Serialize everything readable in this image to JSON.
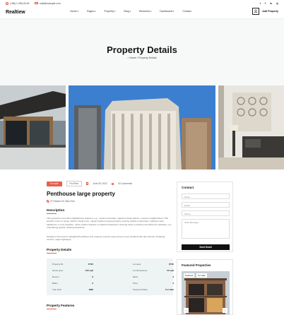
{
  "topbar": {
    "phone": "(+88) 1-256-26-45",
    "email": "mail@example.com",
    "socials": [
      "t",
      "f",
      "in",
      "◎"
    ]
  },
  "header": {
    "logo": "Realtiew",
    "nav": [
      "Home",
      "Pages",
      "Property",
      "Blog",
      "Elements",
      "Dashboard",
      "Contact"
    ],
    "add_property": "Add Property"
  },
  "hero": {
    "title": "Property Details",
    "breadcrumb": "⌂ Home  /  Property Details"
  },
  "listing": {
    "status": "For sale",
    "type": "For Rent",
    "date": "June 09, 2022",
    "comments": "00 Comments",
    "title": "Penthouse large property",
    "address": "27 Division St, New York"
  },
  "description": {
    "heading": "Description",
    "p1": "This property's loca offers highlight key features, e.g., modern amenities, spacious living spaces, a serene neighborhood. This specific rooms or areas, kitchen, living room, master bedroom layout property security granite countertops, stainless steel appliances, a cozy fireplace, views outdoor features. A spacious backyard, stunning views a private pool perfect for activities, e.g., entertaining guests, relaxing weekends.",
    "p2": "Situated in the heart of (Neighborhood/City), this property ensures easy access to key locations like (list schools, shopping centers, major highways)."
  },
  "details": {
    "heading": "Property Details",
    "left": [
      {
        "k": "Property ID:",
        "v": "P720"
      },
      {
        "k": "Home area:",
        "v": "150 sqft"
      },
      {
        "k": "Rooms:",
        "v": "8"
      },
      {
        "k": "Baths:",
        "v": "3"
      },
      {
        "k": "Year built:",
        "v": "1980"
      }
    ],
    "right": [
      {
        "k": "Lot area:",
        "v": "P720"
      },
      {
        "k": "Lot dimensions:",
        "v": "50 sqft"
      },
      {
        "k": "Beds:",
        "v": "3"
      },
      {
        "k": "Price:",
        "v": "3"
      },
      {
        "k": "Property Status:",
        "v": "For Sale"
      }
    ]
  },
  "features_heading": "Property Features",
  "contact": {
    "heading": "Contact",
    "name": "Name",
    "email": "Email",
    "phone": "Phone",
    "message": "Write Message",
    "send": "Send Email"
  },
  "featured": {
    "heading": "Featured Properties",
    "badge1": "Featured",
    "badge2": "For Sale",
    "prev": "‹",
    "next": "›"
  },
  "colors": {
    "accent": "#e8604c",
    "dark": "#111111"
  }
}
